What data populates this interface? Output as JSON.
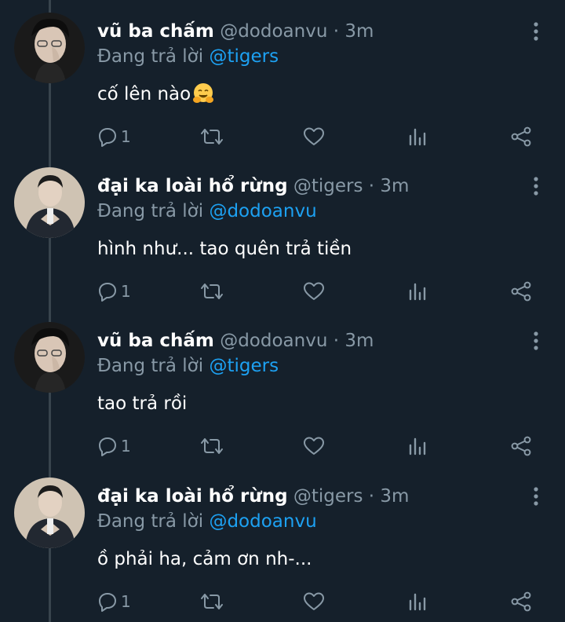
{
  "tweets": [
    {
      "name": "vũ ba chấm",
      "handle": "@dodoanvu",
      "separator": "·",
      "time": "3m",
      "reply_prefix": "Đang trả lời",
      "reply_to": "@tigers",
      "text": "cố lên nào",
      "emoji": "hugging-face",
      "reply_count": "1"
    },
    {
      "name": "đại ka loài hổ rừng",
      "handle": "@tigers",
      "separator": "·",
      "time": "3m",
      "reply_prefix": "Đang trả lời",
      "reply_to": "@dodoanvu",
      "text": "hình như... tao quên trả tiền",
      "reply_count": "1"
    },
    {
      "name": "vũ ba chấm",
      "handle": "@dodoanvu",
      "separator": "·",
      "time": "3m",
      "reply_prefix": "Đang trả lời",
      "reply_to": "@tigers",
      "text": "tao trả rồi",
      "reply_count": "1"
    },
    {
      "name": "đại ka loài hổ rừng",
      "handle": "@tigers",
      "separator": "·",
      "time": "3m",
      "reply_prefix": "Đang trả lời",
      "reply_to": "@dodoanvu",
      "text": "ồ phải ha, cảm ơn nh-...",
      "reply_count": "1"
    }
  ],
  "icons": {
    "reply": "reply-icon",
    "retweet": "retweet-icon",
    "like": "heart-icon",
    "analytics": "analytics-icon",
    "share": "share-icon",
    "more": "more-vertical-icon"
  },
  "colors": {
    "background": "#15202b",
    "thread_line": "#38444d",
    "secondary_text": "#8899a6",
    "link": "#1da1f2",
    "icon": "#8899a6"
  }
}
